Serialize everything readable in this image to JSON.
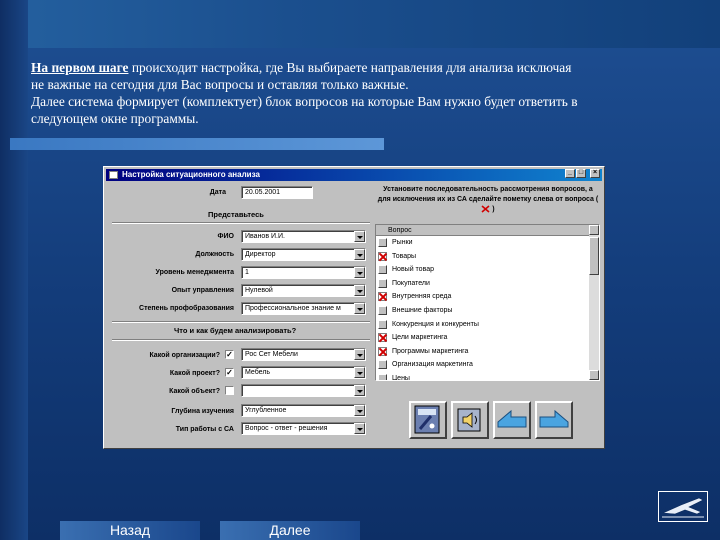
{
  "intro": {
    "lead": "На первом шаге",
    "line1_rest": " происходит настройка, где Вы выбираете направления для анализа исключая",
    "line2": "не важные на сегодня для Вас вопросы и оставляя только важные.",
    "line3": "Далее система формирует (комплектует) блок вопросов на которые Вам нужно будет ответить в",
    "line4": "следующем окне программы."
  },
  "window": {
    "title": "Настройка ситуационного анализа",
    "date_label": "Дата",
    "date_value": "20.05.2001",
    "instruction": "Установите последовательность рассмотрения вопросов, а для исключения их из СА сделайте пометку слева от вопроса (",
    "instruction_end": ")",
    "rep_header": "Представьтесь",
    "fields": [
      {
        "label": "ФИО",
        "value": "Иванов          И.И."
      },
      {
        "label": "Должность",
        "value": "Директор"
      },
      {
        "label": "Уровень менеджмента",
        "value": "1"
      },
      {
        "label": "Опыт управления",
        "value": "Нулевой"
      },
      {
        "label": "Степень профобразования",
        "value": "Профессиональное знание м"
      }
    ],
    "analysis_header": "Что и как будем анализировать?",
    "analysis": [
      {
        "label": "Какой организации?",
        "checked": true,
        "value": "Рос Сет Мебели"
      },
      {
        "label": "Какой проект?",
        "checked": true,
        "value": "Мебель"
      },
      {
        "label": "Какой объект?",
        "checked": false,
        "value": ""
      },
      {
        "label": "Глубина изучения",
        "value": "Углубленное"
      },
      {
        "label": "Тип работы с СА",
        "value": "Вопрос - ответ - решения"
      }
    ],
    "list_header": "Вопрос",
    "questions": [
      {
        "text": "Рынки",
        "excluded": false
      },
      {
        "text": "Товары",
        "excluded": true
      },
      {
        "text": "Новый товар",
        "excluded": false
      },
      {
        "text": "Покупатели",
        "excluded": false
      },
      {
        "text": "Внутренняя среда",
        "excluded": true
      },
      {
        "text": "Внешние факторы",
        "excluded": false
      },
      {
        "text": "Конкуренция и конкуренты",
        "excluded": false
      },
      {
        "text": "Цели маркетинга",
        "excluded": true
      },
      {
        "text": "Программы маркетинга",
        "excluded": true
      },
      {
        "text": "Организация маркетинга",
        "excluded": false
      },
      {
        "text": "Цены",
        "excluded": false
      }
    ],
    "check_mark": "✓"
  },
  "nav": {
    "back": "Назад",
    "next": "Далее"
  },
  "colors": {
    "titlebar": "#000080",
    "background": "#1a4a8c",
    "cross": "#d00000"
  }
}
